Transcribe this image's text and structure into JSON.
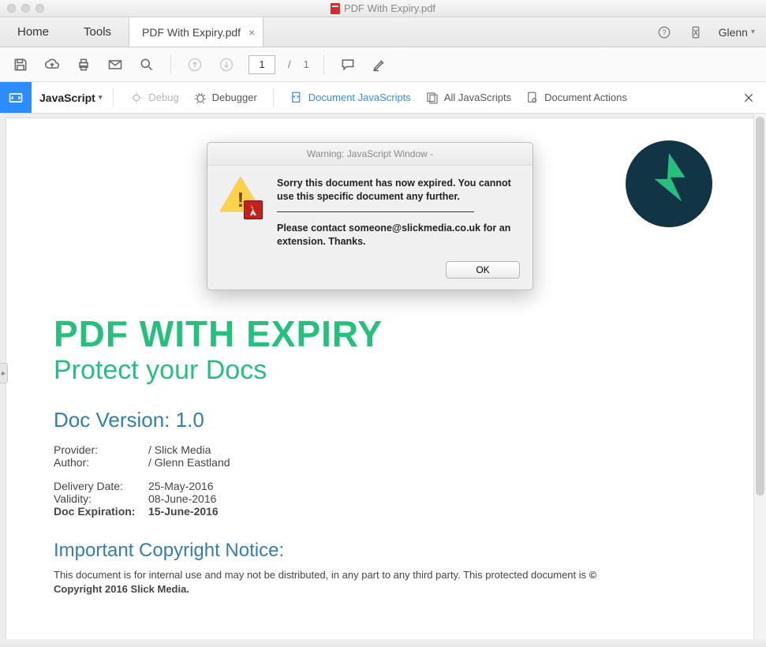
{
  "window": {
    "title": "PDF With Expiry.pdf"
  },
  "primary": {
    "home": "Home",
    "tools": "Tools",
    "doc_tab": "PDF With Expiry.pdf",
    "user": "Glenn"
  },
  "toolbar": {
    "page_current": "1",
    "page_sep": "/",
    "page_total": "1"
  },
  "jsbar": {
    "label": "JavaScript",
    "debug": "Debug",
    "debugger": "Debugger",
    "doc_js": "Document JavaScripts",
    "all_js": "All JavaScripts",
    "doc_actions": "Document Actions"
  },
  "modal": {
    "title": "Warning: JavaScript Window -",
    "para1": "Sorry this document has now expired. You cannot use this specific document any further.",
    "para2": "Please contact someone@slickmedia.co.uk for an extension. Thanks.",
    "ok": "OK"
  },
  "doc": {
    "h1": "PDF WITH EXPIRY",
    "h2": "Protect your Docs",
    "version": "Doc Version: 1.0",
    "provider_k": "Provider:",
    "provider_v": "/ Slick Media",
    "author_k": "Author:",
    "author_v": "/ Glenn Eastland",
    "deliv_k": "Delivery Date:",
    "deliv_v": "25-May-2016",
    "valid_k": "Validity:",
    "valid_v": "08-June-2016",
    "exp_k": "Doc Expiration:",
    "exp_v": "15-June-2016",
    "copy_h": "Important Copyright Notice:",
    "copy_body_pre": "This document is for internal use and may not be distributed, in any part to any third party. This protected document is ",
    "copy_body_bold": "© Copyright 2016 Slick Media."
  }
}
